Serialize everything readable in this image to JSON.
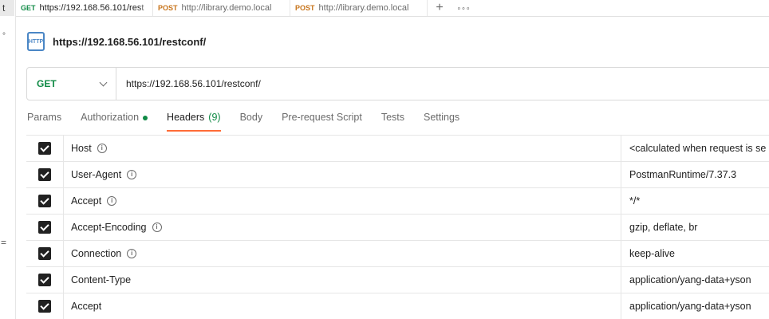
{
  "left_edge": {
    "frag_top": "t",
    "frag_mid": "°",
    "frag_low": "="
  },
  "tabs": [
    {
      "method": "GET",
      "label": "https://192.168.56.101/rest",
      "active": true
    },
    {
      "method": "POST",
      "label": "http://library.demo.local",
      "active": false
    },
    {
      "method": "POST",
      "label": "http://library.demo.local",
      "active": false
    }
  ],
  "tab_actions": {
    "new": "+",
    "more": "∘∘∘"
  },
  "request": {
    "icon_text": "HTTP",
    "title": "https://192.168.56.101/restconf/",
    "method": "GET",
    "url": "https://192.168.56.101/restconf/"
  },
  "subtabs": {
    "params": "Params",
    "authorization": "Authorization",
    "headers": "Headers",
    "headers_count": "(9)",
    "body": "Body",
    "prerequest": "Pre-request Script",
    "tests": "Tests",
    "settings": "Settings"
  },
  "headers": [
    {
      "key": "Host",
      "value": "<calculated when request is se"
    },
    {
      "key": "User-Agent",
      "value": "PostmanRuntime/7.37.3"
    },
    {
      "key": "Accept",
      "value": "*/*"
    },
    {
      "key": "Accept-Encoding",
      "value": "gzip, deflate, br"
    },
    {
      "key": "Connection",
      "value": "keep-alive"
    },
    {
      "key": "Content-Type",
      "value": "application/yang-data+yson"
    },
    {
      "key": "Accept",
      "value": "application/yang-data+yson"
    }
  ],
  "info_glyph": "i",
  "colors": {
    "get": "#0f8a45",
    "post": "#c7741b",
    "accent": "#ff6c37"
  }
}
